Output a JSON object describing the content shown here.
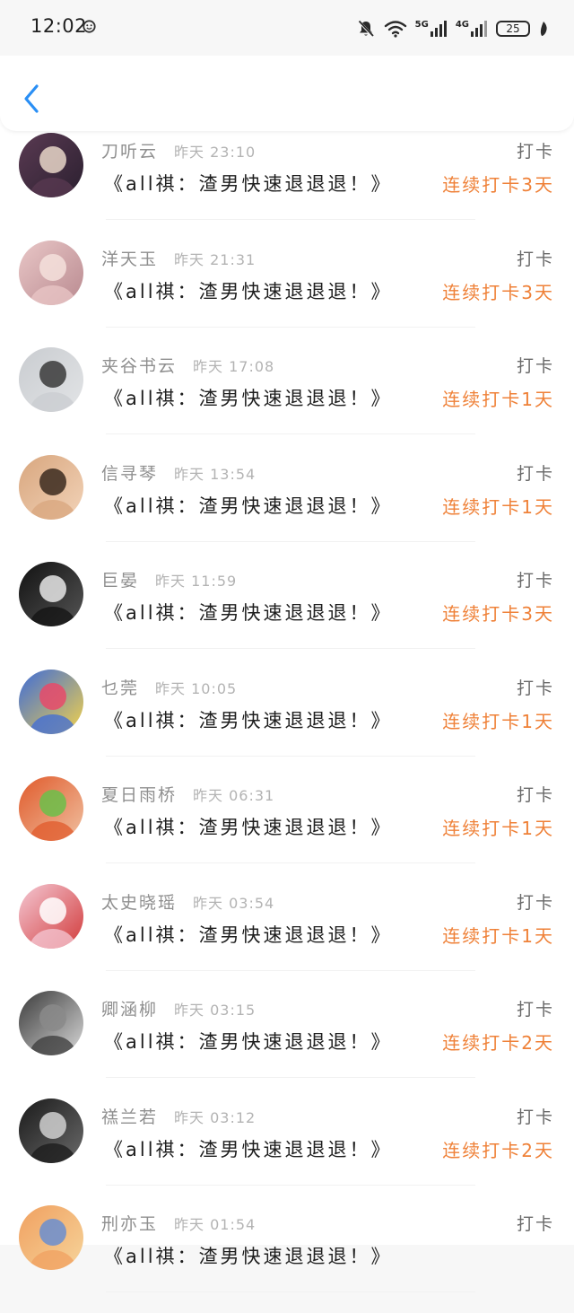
{
  "status": {
    "time": "12:02",
    "net_5g": "5G",
    "net_4g": "4G",
    "battery": "25"
  },
  "header": {
    "back_icon": "chevron-left-icon",
    "accent": "#2a8ff5"
  },
  "colors": {
    "streak": "#ef8138",
    "name": "#8f8f8f",
    "time": "#b3b3b3"
  },
  "items": [
    {
      "name": "刀听云",
      "time": "昨天 23:10",
      "title": "《all祺：渣男快速退退退！》",
      "type": "打卡",
      "streak": "连续打卡3天",
      "avatar_colors": [
        "#5a3a52",
        "#e8d6c8",
        "#2b2030"
      ]
    },
    {
      "name": "洋天玉",
      "time": "昨天 21:31",
      "title": "《all祺：渣男快速退退退！》",
      "type": "打卡",
      "streak": "连续打卡3天",
      "avatar_colors": [
        "#e9c7c7",
        "#f4e0dc",
        "#b98a90"
      ]
    },
    {
      "name": "夹谷书云",
      "time": "昨天 17:08",
      "title": "《all祺：渣男快速退退退！》",
      "type": "打卡",
      "streak": "连续打卡1天",
      "avatar_colors": [
        "#c9ccd0",
        "#3a3a3a",
        "#e2e4e6"
      ]
    },
    {
      "name": "信寻琴",
      "time": "昨天 13:54",
      "title": "《all祺：渣男快速退退退！》",
      "type": "打卡",
      "streak": "连续打卡1天",
      "avatar_colors": [
        "#d8a67e",
        "#3b2a1e",
        "#f2d3b8"
      ]
    },
    {
      "name": "巨晏",
      "time": "昨天 11:59",
      "title": "《all祺：渣男快速退退退！》",
      "type": "打卡",
      "streak": "连续打卡3天",
      "avatar_colors": [
        "#111111",
        "#e6e6e6",
        "#555555"
      ]
    },
    {
      "name": "乜莞",
      "time": "昨天 10:05",
      "title": "《all祺：渣男快速退退退！》",
      "type": "打卡",
      "streak": "连续打卡1天",
      "avatar_colors": [
        "#3d6bd8",
        "#e84a6a",
        "#f3d24a"
      ]
    },
    {
      "name": "夏日雨桥",
      "time": "昨天 06:31",
      "title": "《all祺：渣男快速退退退！》",
      "type": "打卡",
      "streak": "连续打卡1天",
      "avatar_colors": [
        "#e05a2b",
        "#6bbf4a",
        "#f0c0a0"
      ]
    },
    {
      "name": "太史晓瑶",
      "time": "昨天 03:54",
      "title": "《all祺：渣男快速退退退！》",
      "type": "打卡",
      "streak": "连续打卡1天",
      "avatar_colors": [
        "#f4c8d4",
        "#ffffff",
        "#d23b3b"
      ]
    },
    {
      "name": "卿涵柳",
      "time": "昨天 03:15",
      "title": "《all祺：渣男快速退退退！》",
      "type": "打卡",
      "streak": "连续打卡2天",
      "avatar_colors": [
        "#3a3a3a",
        "#8a8a8a",
        "#d8d8d8"
      ]
    },
    {
      "name": "禚兰若",
      "time": "昨天 03:12",
      "title": "《all祺：渣男快速退退退！》",
      "type": "打卡",
      "streak": "连续打卡2天",
      "avatar_colors": [
        "#1a1a1a",
        "#d0d0d0",
        "#6a6a6a"
      ]
    },
    {
      "name": "刑亦玉",
      "time": "昨天 01:54",
      "title": "《all祺：渣男快速退退退！》",
      "type": "打卡",
      "streak": "",
      "avatar_colors": [
        "#f0a060",
        "#6a8ed0",
        "#f6d49a"
      ]
    }
  ]
}
